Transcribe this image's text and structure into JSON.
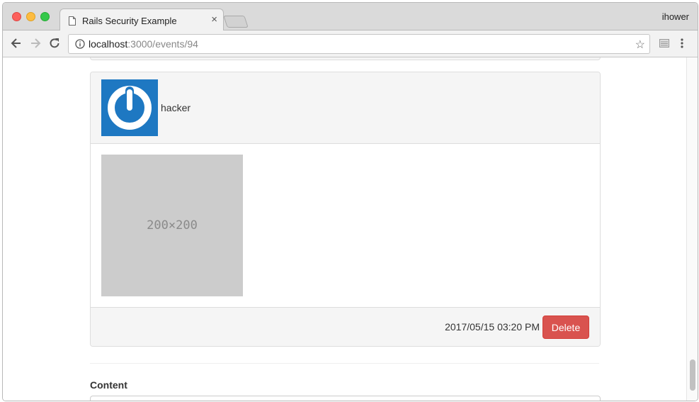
{
  "browser": {
    "tab_title": "Rails Security Example",
    "tab_close": "×",
    "profile_name": "ihower",
    "url_host": "localhost",
    "url_path": ":3000/events/94",
    "star_glyph": "☆"
  },
  "event": {
    "username": "hacker",
    "image_placeholder": "200×200",
    "timestamp": "2017/05/15 03:20 PM",
    "delete_label": "Delete"
  },
  "form": {
    "content_label": "Content",
    "content_value": ""
  },
  "colors": {
    "danger": "#d9534f",
    "avatar_bg": "#1e78c2",
    "panel_bg": "#f5f5f5"
  }
}
